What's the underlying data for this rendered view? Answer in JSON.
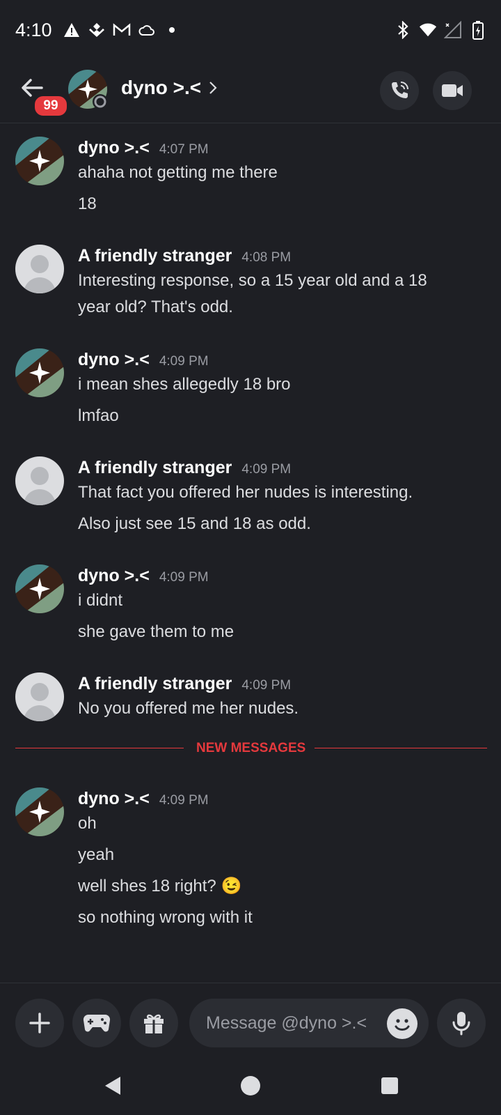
{
  "status_bar": {
    "time": "4:10",
    "left_icons": [
      "warning-icon",
      "app-icon",
      "gmail-icon",
      "cloud-icon",
      "dot-icon"
    ],
    "right_icons": [
      "bluetooth-icon",
      "wifi-icon",
      "signal-icon",
      "battery-icon"
    ]
  },
  "header": {
    "unread_badge": "99",
    "contact_name": "dyno >.<"
  },
  "messages": [
    {
      "author": "dyno >.<",
      "time": "4:07 PM",
      "avatar": "dyno",
      "lines": [
        "ahaha not getting me there",
        "18"
      ]
    },
    {
      "author": "A friendly stranger",
      "time": "4:08 PM",
      "avatar": "default",
      "lines": [
        "Interesting response, so a 15 year old and a 18",
        "year old? That's odd."
      ]
    },
    {
      "author": "dyno >.<",
      "time": "4:09 PM",
      "avatar": "dyno",
      "lines": [
        "i mean shes allegedly 18 bro",
        "lmfao"
      ]
    },
    {
      "author": "A friendly stranger",
      "time": "4:09 PM",
      "avatar": "default",
      "lines": [
        "That fact you offered her nudes is interesting.",
        "Also just see 15 and 18 as odd."
      ]
    },
    {
      "author": "dyno >.<",
      "time": "4:09 PM",
      "avatar": "dyno",
      "lines": [
        "i didnt",
        "she gave them to me"
      ]
    },
    {
      "author": "A friendly stranger",
      "time": "4:09 PM",
      "avatar": "default",
      "lines": [
        "No you offered me her nudes."
      ]
    },
    {
      "author": "dyno >.<",
      "time": "4:09 PM",
      "avatar": "dyno",
      "lines": [
        "oh",
        "yeah",
        "well shes 18 right? 😉",
        "so nothing wrong with it"
      ]
    }
  ],
  "divider": {
    "label": "NEW MESSAGES"
  },
  "composer": {
    "placeholder": "Message @dyno >.<"
  },
  "colors": {
    "background": "#1e1f24",
    "accent_red": "#e5393d",
    "surface": "#2b2d33"
  }
}
